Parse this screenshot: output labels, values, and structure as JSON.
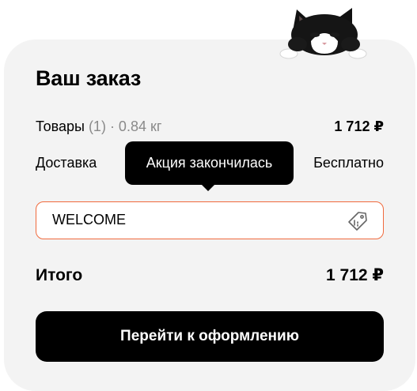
{
  "order": {
    "title": "Ваш заказ",
    "goods_label": "Товары",
    "goods_meta": "(1) · 0.84 кг",
    "goods_amount": "1 712 ₽",
    "delivery_label": "Доставка",
    "delivery_value": "Бесплатно"
  },
  "tooltip": {
    "text": "Акция закончилась"
  },
  "promo": {
    "value": "WELCOME",
    "accent_color": "#f06a3d"
  },
  "total": {
    "label": "Итого",
    "amount": "1 712 ₽"
  },
  "checkout": {
    "label": "Перейти к оформлению"
  },
  "icons": {
    "promo": "tag-icon",
    "mascot": "cat-mascot-icon"
  }
}
